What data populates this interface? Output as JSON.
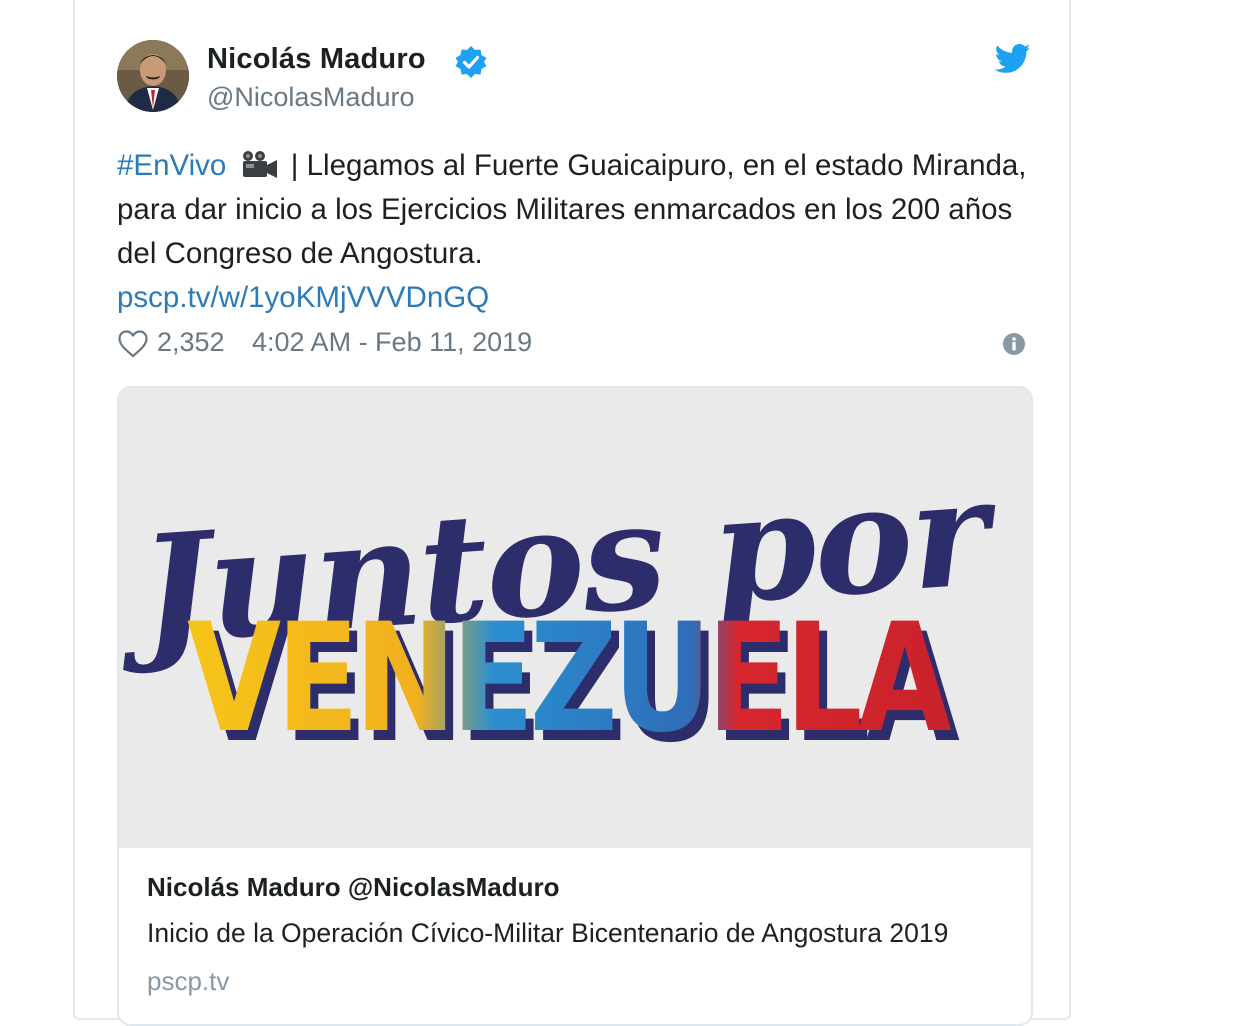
{
  "tweet": {
    "author_name": "Nicolás Maduro",
    "handle": "@NicolasMaduro",
    "hashtag": "#EnVivo",
    "text": " | Llegamos al Fuerte Guaicaipuro, en el estado Miranda, para dar inicio a los Ejercicios Militares enmarcados en los 200 años del Congreso de Angostura.",
    "link": "pscp.tv/w/1yoKMjVVVDnGQ",
    "likes": "2,352",
    "timestamp": "4:02 AM - Feb 11, 2019"
  },
  "card": {
    "image_text_top": "Juntos por",
    "image_text_bottom": "VENEZUELA",
    "title": "Nicolás Maduro @NicolasMaduro",
    "description": "Inicio de la Operación Cívico-Militar Bicentenario de Angostura 2019",
    "domain": "pscp.tv"
  },
  "icons": {
    "verified": "verified-badge-icon",
    "brand": "twitter-bird-icon",
    "camera": "movie-camera-icon",
    "like": "heart-icon",
    "info": "info-icon"
  },
  "colors": {
    "link": "#2b7bb9",
    "twitter_blue": "#1da1f2",
    "text": "#1c2022",
    "muted": "#697882"
  }
}
